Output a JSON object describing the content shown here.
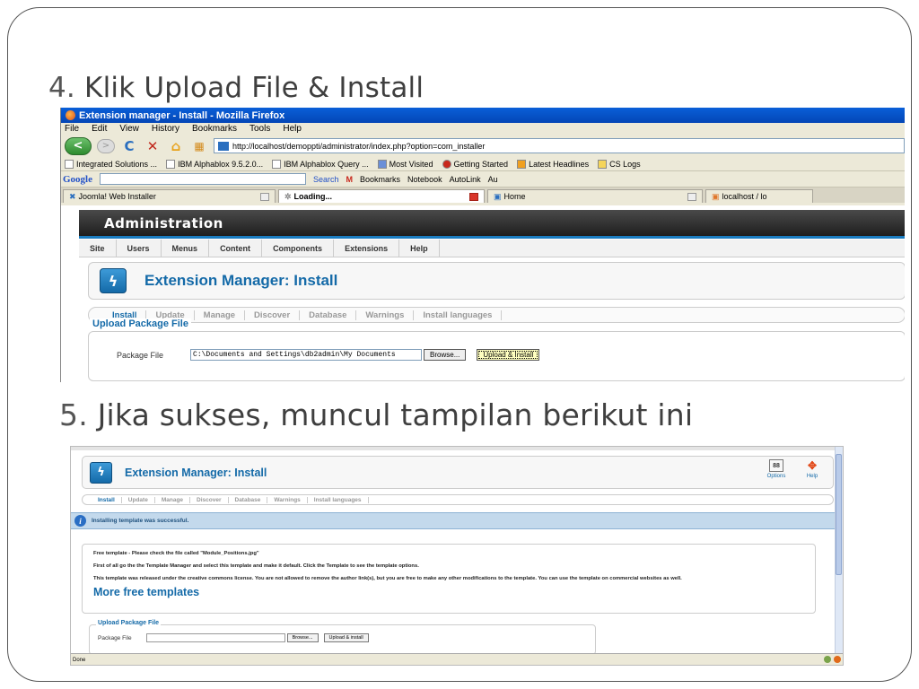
{
  "slide": {
    "heading1": {
      "num": "4.",
      "text": " Klik Upload File & Install"
    },
    "heading2": {
      "num": "5.",
      "text": " Jika sukses, muncul tampilan berikut ini"
    }
  },
  "browser": {
    "title": "Extension manager - Install - Mozilla Firefox",
    "menu": [
      "File",
      "Edit",
      "View",
      "History",
      "Bookmarks",
      "Tools",
      "Help"
    ],
    "url": "http://localhost/demoppti/administrator/index.php?option=com_installer",
    "bookmarks": [
      "Integrated Solutions ...",
      "IBM Alphablox 9.5.2.0...",
      "IBM Alphablox Query ...",
      "Most Visited",
      "Getting Started",
      "Latest Headlines",
      "CS Logs"
    ],
    "google_bar": {
      "logo": "Google",
      "search": "Search",
      "bookmarks": "Bookmarks",
      "notebook": "Notebook",
      "autolink": "AutoLink",
      "extra": "Au"
    },
    "tabs": [
      {
        "label": "Joomla! Web Installer"
      },
      {
        "label": "Loading..."
      },
      {
        "label": "Home"
      },
      {
        "label": "localhost / lo"
      }
    ]
  },
  "admin": {
    "bar_title": "Administration",
    "menu": [
      "Site",
      "Users",
      "Menus",
      "Content",
      "Components",
      "Extensions",
      "Help"
    ],
    "page_title": "Extension Manager: Install",
    "subtabs": [
      "Install",
      "Update",
      "Manage",
      "Discover",
      "Database",
      "Warnings",
      "Install languages"
    ],
    "upload": {
      "legend": "Upload Package File",
      "label": "Package File",
      "file_value": "C:\\Documents and Settings\\db2admin\\My Documents",
      "browse": "Browse...",
      "install": "Upload & Install"
    }
  },
  "result": {
    "page_title": "Extension Manager: Install",
    "tools": [
      {
        "icon": "88",
        "label": "Options"
      },
      {
        "icon": "✥",
        "label": "Help"
      }
    ],
    "subtabs": [
      "Install",
      "Update",
      "Manage",
      "Discover",
      "Database",
      "Warnings",
      "Install languages"
    ],
    "message": "Installing template was successful.",
    "body": [
      "Free template - Please check the file called \"Module_Positions.jpg\"",
      "First of all go the the Template Manager and select this template and make it default. Click the Template to see the template options.",
      "This template was released under the creative commons license. You are not allowed to remove the author link(s), but you are free to make any other modifications to the template. You can use the template on commercial websites as well."
    ],
    "more": "More free templates",
    "upload": {
      "legend": "Upload Package File",
      "label": "Package File",
      "browse": "Browse...",
      "install": "Upload & install"
    },
    "status": "Done"
  }
}
